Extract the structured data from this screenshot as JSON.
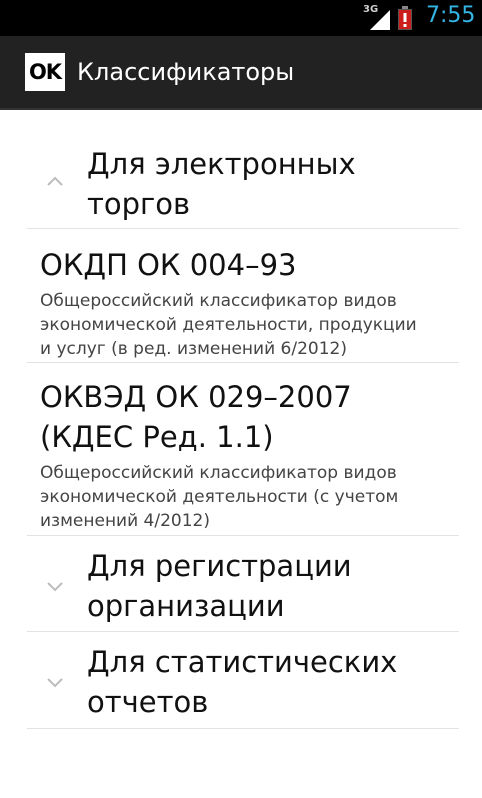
{
  "status_bar": {
    "network": "3G",
    "time": "7:55"
  },
  "action_bar": {
    "logo_text": "OK",
    "title": "Классификаторы"
  },
  "groups": [
    {
      "title_line1": "Для электронных",
      "title_line2": "торгов",
      "expanded": true,
      "items": [
        {
          "title_line1": "ОКДП ОК 004–93",
          "desc_line1": "Общероссийский классификатор видов",
          "desc_line2": "экономической деятельности, продукции",
          "desc_line3": "и услуг (в ред. изменений 6/2012)"
        },
        {
          "title_line1": "ОКВЭД ОК 029–2007",
          "title_line2": "(КДЕС Ред. 1.1)",
          "desc_line1": "Общероссийский классификатор видов",
          "desc_line2": "экономической деятельности (с учетом",
          "desc_line3": "изменений 4/2012)"
        }
      ]
    },
    {
      "title_line1": "Для регистрации",
      "title_line2": "организации",
      "expanded": false
    },
    {
      "title_line1": "Для статистических",
      "title_line2": "отчетов",
      "expanded": false
    }
  ]
}
